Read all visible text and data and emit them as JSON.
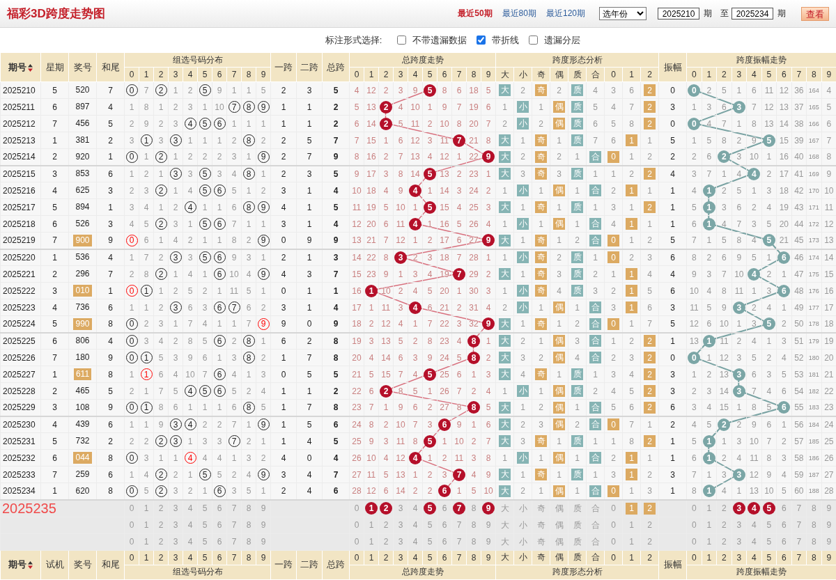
{
  "title": "福彩3D跨度走势图",
  "ranges": [
    {
      "label": "最近50期",
      "selected": true
    },
    {
      "label": "最近80期",
      "selected": false
    },
    {
      "label": "最近120期",
      "selected": false
    }
  ],
  "year_select": "选年份",
  "from": {
    "value": "2025210",
    "unit": "期"
  },
  "to_label": "至",
  "to": {
    "value": "2025234",
    "unit": "期"
  },
  "view_button": "查看",
  "options_label": "标注形式选择:",
  "options": [
    {
      "label": "不带遗漏数据",
      "checked": false
    },
    {
      "label": "带折线",
      "checked": true
    },
    {
      "label": "遗漏分层",
      "checked": false
    }
  ],
  "header": {
    "period": "期号",
    "weekday": "星期",
    "number": "奖号",
    "tail": "和尾",
    "dist_title": "组选号码分布",
    "dist_cols": [
      "0",
      "1",
      "2",
      "3",
      "4",
      "5",
      "6",
      "7",
      "8",
      "9"
    ],
    "span1": "一跨",
    "span2": "二跨",
    "span_total": "总跨",
    "span_title": "总跨度走势",
    "span_cols": [
      "0",
      "1",
      "2",
      "3",
      "4",
      "5",
      "6",
      "7",
      "8",
      "9"
    ],
    "shape_title": "跨度形态分析",
    "shape_cols": [
      "大",
      "小",
      "奇",
      "偶",
      "质",
      "合",
      "0",
      "1",
      "2"
    ],
    "amp": "振幅",
    "amp_title": "跨度振幅走势",
    "amp_cols": [
      "0",
      "1",
      "2",
      "3",
      "4",
      "5",
      "6",
      "7",
      "8",
      "9"
    ]
  },
  "rows": [
    {
      "period": "2025210",
      "weekday": "5",
      "number": "520",
      "highlighted": false,
      "tail": "7",
      "dist": [
        {
          "value": "0",
          "kind": "ring"
        },
        "7",
        {
          "value": "2",
          "kind": "ring"
        },
        "1",
        "2",
        {
          "value": "5",
          "kind": "ring"
        },
        "9",
        "1",
        "1",
        "5"
      ],
      "span1": "2",
      "span2": "3",
      "span": "5",
      "span_trend": [
        "4",
        "12",
        "2",
        "3",
        "9",
        {
          "value": "5",
          "kind": "ball"
        },
        "8",
        "6",
        "18",
        "5"
      ],
      "shape": [
        {
          "value": "大",
          "kind": "teal"
        },
        "2",
        {
          "value": "奇",
          "kind": "gold"
        },
        "2",
        {
          "value": "质",
          "kind": "teal"
        },
        "4",
        "3",
        "6",
        {
          "value": "2",
          "kind": "gold"
        }
      ],
      "amp": "0",
      "amp_trend": [
        {
          "value": "0",
          "kind": "ball"
        },
        "2",
        "5",
        "1",
        "6",
        "11",
        "12",
        "36",
        "164",
        "4"
      ]
    },
    {
      "period": "2025211",
      "weekday": "6",
      "number": "897",
      "highlighted": false,
      "tail": "4",
      "dist": [
        "1",
        "8",
        "1",
        "2",
        "3",
        "1",
        "10",
        {
          "value": "7",
          "kind": "ring"
        },
        {
          "value": "8",
          "kind": "ring"
        },
        {
          "value": "9",
          "kind": "ring"
        }
      ],
      "span1": "1",
      "span2": "1",
      "span": "2",
      "span_trend": [
        "5",
        "13",
        {
          "value": "2",
          "kind": "ball"
        },
        "4",
        "10",
        "1",
        "9",
        "7",
        "19",
        "6"
      ],
      "shape": [
        "1",
        {
          "value": "小",
          "kind": "teal"
        },
        "1",
        {
          "value": "偶",
          "kind": "gold"
        },
        {
          "value": "质",
          "kind": "teal"
        },
        "5",
        "4",
        "7",
        {
          "value": "2",
          "kind": "gold"
        }
      ],
      "amp": "3",
      "amp_trend": [
        "1",
        "3",
        "6",
        {
          "value": "3",
          "kind": "ball"
        },
        "7",
        "12",
        "13",
        "37",
        "165",
        "5"
      ]
    },
    {
      "period": "2025212",
      "weekday": "7",
      "number": "456",
      "highlighted": false,
      "tail": "5",
      "dist": [
        "2",
        "9",
        "2",
        "3",
        {
          "value": "4",
          "kind": "ring"
        },
        {
          "value": "5",
          "kind": "ring"
        },
        {
          "value": "6",
          "kind": "ring"
        },
        "1",
        "1",
        "1"
      ],
      "span1": "1",
      "span2": "1",
      "span": "2",
      "span_trend": [
        "6",
        "14",
        {
          "value": "2",
          "kind": "ball"
        },
        "5",
        "11",
        "2",
        "10",
        "8",
        "20",
        "7"
      ],
      "shape": [
        "2",
        {
          "value": "小",
          "kind": "teal"
        },
        "2",
        {
          "value": "偶",
          "kind": "gold"
        },
        {
          "value": "质",
          "kind": "teal"
        },
        "6",
        "5",
        "8",
        {
          "value": "2",
          "kind": "gold"
        }
      ],
      "amp": "0",
      "amp_trend": [
        {
          "value": "0",
          "kind": "ball"
        },
        "4",
        "7",
        "1",
        "8",
        "13",
        "14",
        "38",
        "166",
        "6"
      ]
    },
    {
      "period": "2025213",
      "weekday": "1",
      "number": "381",
      "highlighted": false,
      "tail": "2",
      "dist": [
        "3",
        {
          "value": "1",
          "kind": "ring"
        },
        "3",
        {
          "value": "3",
          "kind": "ring"
        },
        "1",
        "1",
        "1",
        "2",
        {
          "value": "8",
          "kind": "ring"
        },
        "2"
      ],
      "span1": "2",
      "span2": "5",
      "span": "7",
      "span_trend": [
        "7",
        "15",
        "1",
        "6",
        "12",
        "3",
        "11",
        {
          "value": "7",
          "kind": "ball"
        },
        "21",
        "8"
      ],
      "shape": [
        {
          "value": "大",
          "kind": "teal"
        },
        "1",
        {
          "value": "奇",
          "kind": "gold"
        },
        "1",
        {
          "value": "质",
          "kind": "teal"
        },
        "7",
        "6",
        {
          "value": "1",
          "kind": "gold"
        },
        "1"
      ],
      "amp": "5",
      "amp_trend": [
        "1",
        "5",
        "8",
        "2",
        "9",
        {
          "value": "5",
          "kind": "ball"
        },
        "15",
        "39",
        "167",
        "7"
      ]
    },
    {
      "period": "2025214",
      "weekday": "2",
      "number": "920",
      "highlighted": false,
      "tail": "1",
      "dist": [
        {
          "value": "0",
          "kind": "ring"
        },
        "1",
        {
          "value": "2",
          "kind": "ring"
        },
        "1",
        "2",
        "2",
        "2",
        "3",
        "1",
        {
          "value": "9",
          "kind": "ring"
        }
      ],
      "span1": "2",
      "span2": "7",
      "span": "9",
      "span_trend": [
        "8",
        "16",
        "2",
        "7",
        "13",
        "4",
        "12",
        "1",
        "22",
        {
          "value": "9",
          "kind": "ball"
        }
      ],
      "shape": [
        {
          "value": "大",
          "kind": "teal"
        },
        "2",
        {
          "value": "奇",
          "kind": "gold"
        },
        "2",
        "1",
        {
          "value": "合",
          "kind": "teal"
        },
        {
          "value": "0",
          "kind": "gold"
        },
        "1",
        "2"
      ],
      "amp": "2",
      "amp_trend": [
        "2",
        "6",
        {
          "value": "2",
          "kind": "ball"
        },
        "3",
        "10",
        "1",
        "16",
        "40",
        "168",
        "8"
      ]
    },
    {
      "period": "2025215",
      "weekday": "3",
      "number": "853",
      "highlighted": false,
      "tail": "6",
      "dist": [
        "1",
        "2",
        "1",
        {
          "value": "3",
          "kind": "ring"
        },
        "3",
        {
          "value": "5",
          "kind": "ring"
        },
        "3",
        "4",
        {
          "value": "8",
          "kind": "ring"
        },
        "1"
      ],
      "span1": "2",
      "span2": "3",
      "span": "5",
      "span_trend": [
        "9",
        "17",
        "3",
        "8",
        "14",
        {
          "value": "5",
          "kind": "ball"
        },
        "13",
        "2",
        "23",
        "1"
      ],
      "shape": [
        {
          "value": "大",
          "kind": "teal"
        },
        "3",
        {
          "value": "奇",
          "kind": "gold"
        },
        "3",
        {
          "value": "质",
          "kind": "teal"
        },
        "1",
        "1",
        "2",
        {
          "value": "2",
          "kind": "gold"
        }
      ],
      "amp": "4",
      "amp_trend": [
        "3",
        "7",
        "1",
        "4",
        {
          "value": "4",
          "kind": "ball"
        },
        "2",
        "17",
        "41",
        "169",
        "9"
      ]
    },
    {
      "period": "2025216",
      "weekday": "4",
      "number": "625",
      "highlighted": false,
      "tail": "3",
      "dist": [
        "2",
        "3",
        {
          "value": "2",
          "kind": "ring"
        },
        "1",
        "4",
        {
          "value": "5",
          "kind": "ring"
        },
        {
          "value": "6",
          "kind": "ring"
        },
        "5",
        "1",
        "2"
      ],
      "span1": "3",
      "span2": "1",
      "span": "4",
      "span_trend": [
        "10",
        "18",
        "4",
        "9",
        {
          "value": "4",
          "kind": "ball"
        },
        "1",
        "14",
        "3",
        "24",
        "2"
      ],
      "shape": [
        "1",
        {
          "value": "小",
          "kind": "teal"
        },
        "1",
        {
          "value": "偶",
          "kind": "gold"
        },
        "1",
        {
          "value": "合",
          "kind": "teal"
        },
        "2",
        {
          "value": "1",
          "kind": "gold"
        },
        "1"
      ],
      "amp": "1",
      "amp_trend": [
        "4",
        {
          "value": "1",
          "kind": "ball"
        },
        "2",
        "5",
        "1",
        "3",
        "18",
        "42",
        "170",
        "10"
      ]
    },
    {
      "period": "2025217",
      "weekday": "5",
      "number": "894",
      "highlighted": false,
      "tail": "1",
      "dist": [
        "3",
        "4",
        "1",
        "2",
        {
          "value": "4",
          "kind": "ring"
        },
        "1",
        "1",
        "6",
        {
          "value": "8",
          "kind": "ring"
        },
        {
          "value": "9",
          "kind": "ring"
        }
      ],
      "span1": "4",
      "span2": "1",
      "span": "5",
      "span_trend": [
        "11",
        "19",
        "5",
        "10",
        "1",
        {
          "value": "5",
          "kind": "ball"
        },
        "15",
        "4",
        "25",
        "3"
      ],
      "shape": [
        {
          "value": "大",
          "kind": "teal"
        },
        "1",
        {
          "value": "奇",
          "kind": "gold"
        },
        "1",
        {
          "value": "质",
          "kind": "teal"
        },
        "1",
        "3",
        "1",
        {
          "value": "2",
          "kind": "gold"
        }
      ],
      "amp": "1",
      "amp_trend": [
        "5",
        {
          "value": "1",
          "kind": "ball"
        },
        "3",
        "6",
        "2",
        "4",
        "19",
        "43",
        "171",
        "11"
      ]
    },
    {
      "period": "2025218",
      "weekday": "6",
      "number": "526",
      "highlighted": false,
      "tail": "3",
      "dist": [
        "4",
        "5",
        {
          "value": "2",
          "kind": "ring"
        },
        "3",
        "1",
        {
          "value": "5",
          "kind": "ring"
        },
        {
          "value": "6",
          "kind": "ring"
        },
        "7",
        "1",
        "1"
      ],
      "span1": "3",
      "span2": "1",
      "span": "4",
      "span_trend": [
        "12",
        "20",
        "6",
        "11",
        {
          "value": "4",
          "kind": "ball"
        },
        "1",
        "16",
        "5",
        "26",
        "4"
      ],
      "shape": [
        "1",
        {
          "value": "小",
          "kind": "teal"
        },
        "1",
        {
          "value": "偶",
          "kind": "gold"
        },
        "1",
        {
          "value": "合",
          "kind": "teal"
        },
        "4",
        {
          "value": "1",
          "kind": "gold"
        },
        "1"
      ],
      "amp": "1",
      "amp_trend": [
        "6",
        {
          "value": "1",
          "kind": "ball"
        },
        "4",
        "7",
        "3",
        "5",
        "20",
        "44",
        "172",
        "12"
      ]
    },
    {
      "period": "2025219",
      "weekday": "7",
      "number": "900",
      "highlighted": true,
      "tail": "9",
      "dist": [
        {
          "value": "0",
          "kind": "redring"
        },
        "6",
        "1",
        "4",
        "2",
        "1",
        "1",
        "8",
        "2",
        {
          "value": "9",
          "kind": "ring"
        }
      ],
      "span1": "0",
      "span2": "9",
      "span": "9",
      "span_trend": [
        "13",
        "21",
        "7",
        "12",
        "1",
        "2",
        "17",
        "6",
        "27",
        {
          "value": "9",
          "kind": "ball"
        }
      ],
      "shape": [
        {
          "value": "大",
          "kind": "teal"
        },
        "1",
        {
          "value": "奇",
          "kind": "gold"
        },
        "1",
        "2",
        {
          "value": "合",
          "kind": "teal"
        },
        {
          "value": "0",
          "kind": "gold"
        },
        "1",
        "2"
      ],
      "amp": "5",
      "amp_trend": [
        "7",
        "1",
        "5",
        "8",
        "4",
        {
          "value": "5",
          "kind": "ball"
        },
        "21",
        "45",
        "173",
        "13"
      ]
    },
    {
      "period": "2025220",
      "weekday": "1",
      "number": "536",
      "highlighted": false,
      "tail": "4",
      "dist": [
        "1",
        "7",
        "2",
        {
          "value": "3",
          "kind": "ring"
        },
        "3",
        {
          "value": "5",
          "kind": "ring"
        },
        {
          "value": "6",
          "kind": "ring"
        },
        "9",
        "3",
        "1"
      ],
      "span1": "2",
      "span2": "1",
      "span": "3",
      "span_trend": [
        "14",
        "22",
        "8",
        {
          "value": "3",
          "kind": "ball"
        },
        "2",
        "3",
        "18",
        "7",
        "28",
        "1"
      ],
      "shape": [
        "1",
        {
          "value": "小",
          "kind": "teal"
        },
        {
          "value": "奇",
          "kind": "gold"
        },
        "2",
        {
          "value": "质",
          "kind": "teal"
        },
        "1",
        {
          "value": "0",
          "kind": "gold"
        },
        "2",
        "3"
      ],
      "amp": "6",
      "amp_trend": [
        "8",
        "2",
        "6",
        "9",
        "5",
        "1",
        {
          "value": "6",
          "kind": "ball"
        },
        "46",
        "174",
        "14"
      ]
    },
    {
      "period": "2025221",
      "weekday": "2",
      "number": "296",
      "highlighted": false,
      "tail": "7",
      "dist": [
        "2",
        "8",
        {
          "value": "2",
          "kind": "ring"
        },
        "1",
        "4",
        "1",
        {
          "value": "6",
          "kind": "ring"
        },
        "10",
        "4",
        {
          "value": "9",
          "kind": "ring"
        }
      ],
      "span1": "4",
      "span2": "3",
      "span": "7",
      "span_trend": [
        "15",
        "23",
        "9",
        "1",
        "3",
        "4",
        "19",
        {
          "value": "7",
          "kind": "ball"
        },
        "29",
        "2"
      ],
      "shape": [
        {
          "value": "大",
          "kind": "teal"
        },
        "1",
        {
          "value": "奇",
          "kind": "gold"
        },
        "3",
        {
          "value": "质",
          "kind": "teal"
        },
        "2",
        "1",
        {
          "value": "1",
          "kind": "gold"
        },
        "4"
      ],
      "amp": "4",
      "amp_trend": [
        "9",
        "3",
        "7",
        "10",
        {
          "value": "4",
          "kind": "ball"
        },
        "2",
        "1",
        "47",
        "175",
        "15"
      ]
    },
    {
      "period": "2025222",
      "weekday": "3",
      "number": "010",
      "highlighted": true,
      "tail": "1",
      "dist": [
        {
          "value": "0",
          "kind": "redring"
        },
        {
          "value": "1",
          "kind": "ring"
        },
        "1",
        "2",
        "5",
        "2",
        "1",
        "11",
        "5",
        "1"
      ],
      "span1": "0",
      "span2": "1",
      "span": "1",
      "span_trend": [
        "16",
        {
          "value": "1",
          "kind": "ball"
        },
        "10",
        "2",
        "4",
        "5",
        "20",
        "1",
        "30",
        "3"
      ],
      "shape": [
        "1",
        {
          "value": "小",
          "kind": "teal"
        },
        {
          "value": "奇",
          "kind": "gold"
        },
        "4",
        {
          "value": "质",
          "kind": "teal"
        },
        "3",
        "2",
        {
          "value": "1",
          "kind": "gold"
        },
        "5"
      ],
      "amp": "6",
      "amp_trend": [
        "10",
        "4",
        "8",
        "11",
        "1",
        "3",
        {
          "value": "6",
          "kind": "ball"
        },
        "48",
        "176",
        "16"
      ]
    },
    {
      "period": "2025223",
      "weekday": "4",
      "number": "736",
      "highlighted": false,
      "tail": "6",
      "dist": [
        "1",
        "1",
        "2",
        {
          "value": "3",
          "kind": "ring"
        },
        "6",
        "3",
        {
          "value": "6",
          "kind": "ring"
        },
        {
          "value": "7",
          "kind": "ring"
        },
        "6",
        "2"
      ],
      "span1": "3",
      "span2": "1",
      "span": "4",
      "span_trend": [
        "17",
        "1",
        "11",
        "3",
        {
          "value": "4",
          "kind": "ball"
        },
        "6",
        "21",
        "2",
        "31",
        "4"
      ],
      "shape": [
        "2",
        {
          "value": "小",
          "kind": "teal"
        },
        "1",
        {
          "value": "偶",
          "kind": "gold"
        },
        "1",
        {
          "value": "合",
          "kind": "teal"
        },
        "3",
        {
          "value": "1",
          "kind": "gold"
        },
        "6"
      ],
      "amp": "3",
      "amp_trend": [
        "11",
        "5",
        "9",
        {
          "value": "3",
          "kind": "ball"
        },
        "2",
        "4",
        "1",
        "49",
        "177",
        "17"
      ]
    },
    {
      "period": "2025224",
      "weekday": "5",
      "number": "990",
      "highlighted": true,
      "tail": "8",
      "dist": [
        {
          "value": "0",
          "kind": "ring"
        },
        "2",
        "3",
        "1",
        "7",
        "4",
        "1",
        "1",
        "7",
        {
          "value": "9",
          "kind": "redring"
        }
      ],
      "span1": "9",
      "span2": "0",
      "span": "9",
      "span_trend": [
        "18",
        "2",
        "12",
        "4",
        "1",
        "7",
        "22",
        "3",
        "32",
        {
          "value": "9",
          "kind": "ball"
        }
      ],
      "shape": [
        {
          "value": "大",
          "kind": "teal"
        },
        "1",
        {
          "value": "奇",
          "kind": "gold"
        },
        "1",
        "2",
        {
          "value": "合",
          "kind": "teal"
        },
        {
          "value": "0",
          "kind": "gold"
        },
        "1",
        "7"
      ],
      "amp": "5",
      "amp_trend": [
        "12",
        "6",
        "10",
        "1",
        "3",
        {
          "value": "5",
          "kind": "ball"
        },
        "2",
        "50",
        "178",
        "18"
      ]
    },
    {
      "period": "2025225",
      "weekday": "6",
      "number": "806",
      "highlighted": false,
      "tail": "4",
      "dist": [
        {
          "value": "0",
          "kind": "ring"
        },
        "3",
        "4",
        "2",
        "8",
        "5",
        {
          "value": "6",
          "kind": "ring"
        },
        "2",
        {
          "value": "8",
          "kind": "ring"
        },
        "1"
      ],
      "span1": "6",
      "span2": "2",
      "span": "8",
      "span_trend": [
        "19",
        "3",
        "13",
        "5",
        "2",
        "8",
        "23",
        "4",
        {
          "value": "8",
          "kind": "ball"
        },
        "1"
      ],
      "shape": [
        {
          "value": "大",
          "kind": "teal"
        },
        "2",
        "1",
        {
          "value": "偶",
          "kind": "gold"
        },
        "3",
        {
          "value": "合",
          "kind": "teal"
        },
        "1",
        "2",
        {
          "value": "2",
          "kind": "gold"
        }
      ],
      "amp": "1",
      "amp_trend": [
        "13",
        {
          "value": "1",
          "kind": "ball"
        },
        "11",
        "2",
        "4",
        "1",
        "3",
        "51",
        "179",
        "19"
      ]
    },
    {
      "period": "2025226",
      "weekday": "7",
      "number": "180",
      "highlighted": false,
      "tail": "9",
      "dist": [
        {
          "value": "0",
          "kind": "ring"
        },
        {
          "value": "1",
          "kind": "ring"
        },
        "5",
        "3",
        "9",
        "6",
        "1",
        "3",
        {
          "value": "8",
          "kind": "ring"
        },
        "2"
      ],
      "span1": "1",
      "span2": "7",
      "span": "8",
      "span_trend": [
        "20",
        "4",
        "14",
        "6",
        "3",
        "9",
        "24",
        "5",
        {
          "value": "8",
          "kind": "ball"
        },
        "2"
      ],
      "shape": [
        {
          "value": "大",
          "kind": "teal"
        },
        "3",
        "2",
        {
          "value": "偶",
          "kind": "gold"
        },
        "4",
        {
          "value": "合",
          "kind": "teal"
        },
        "2",
        "3",
        {
          "value": "2",
          "kind": "gold"
        }
      ],
      "amp": "0",
      "amp_trend": [
        {
          "value": "0",
          "kind": "ball"
        },
        "1",
        "12",
        "3",
        "5",
        "2",
        "4",
        "52",
        "180",
        "20"
      ]
    },
    {
      "period": "2025227",
      "weekday": "1",
      "number": "611",
      "highlighted": true,
      "tail": "8",
      "dist": [
        "1",
        {
          "value": "1",
          "kind": "redring"
        },
        "6",
        "4",
        "10",
        "7",
        {
          "value": "6",
          "kind": "ring"
        },
        "4",
        "1",
        "3"
      ],
      "span1": "0",
      "span2": "5",
      "span": "5",
      "span_trend": [
        "21",
        "5",
        "15",
        "7",
        "4",
        {
          "value": "5",
          "kind": "ball"
        },
        "25",
        "6",
        "1",
        "3"
      ],
      "shape": [
        {
          "value": "大",
          "kind": "teal"
        },
        "4",
        {
          "value": "奇",
          "kind": "gold"
        },
        "1",
        {
          "value": "质",
          "kind": "teal"
        },
        "1",
        "3",
        "4",
        {
          "value": "2",
          "kind": "gold"
        }
      ],
      "amp": "3",
      "amp_trend": [
        "1",
        "2",
        "13",
        {
          "value": "3",
          "kind": "ball"
        },
        "6",
        "3",
        "5",
        "53",
        "181",
        "21"
      ]
    },
    {
      "period": "2025228",
      "weekday": "2",
      "number": "465",
      "highlighted": false,
      "tail": "5",
      "dist": [
        "2",
        "1",
        "7",
        "5",
        {
          "value": "4",
          "kind": "ring"
        },
        {
          "value": "5",
          "kind": "ring"
        },
        {
          "value": "6",
          "kind": "ring"
        },
        "5",
        "2",
        "4"
      ],
      "span1": "1",
      "span2": "1",
      "span": "2",
      "span_trend": [
        "22",
        "6",
        {
          "value": "2",
          "kind": "ball"
        },
        "8",
        "5",
        "1",
        "26",
        "7",
        "2",
        "4"
      ],
      "shape": [
        "1",
        {
          "value": "小",
          "kind": "teal"
        },
        "1",
        {
          "value": "偶",
          "kind": "gold"
        },
        {
          "value": "质",
          "kind": "teal"
        },
        "2",
        "4",
        "5",
        {
          "value": "2",
          "kind": "gold"
        }
      ],
      "amp": "3",
      "amp_trend": [
        "2",
        "3",
        "14",
        {
          "value": "3",
          "kind": "ball"
        },
        "7",
        "4",
        "6",
        "54",
        "182",
        "22"
      ]
    },
    {
      "period": "2025229",
      "weekday": "3",
      "number": "108",
      "highlighted": false,
      "tail": "9",
      "dist": [
        {
          "value": "0",
          "kind": "ring"
        },
        {
          "value": "1",
          "kind": "ring"
        },
        "8",
        "6",
        "1",
        "1",
        "1",
        "6",
        {
          "value": "8",
          "kind": "ring"
        },
        "5"
      ],
      "span1": "1",
      "span2": "7",
      "span": "8",
      "span_trend": [
        "23",
        "7",
        "1",
        "9",
        "6",
        "2",
        "27",
        "8",
        {
          "value": "8",
          "kind": "ball"
        },
        "5"
      ],
      "shape": [
        {
          "value": "大",
          "kind": "teal"
        },
        "1",
        "2",
        {
          "value": "偶",
          "kind": "gold"
        },
        "1",
        {
          "value": "合",
          "kind": "teal"
        },
        "5",
        "6",
        {
          "value": "2",
          "kind": "gold"
        }
      ],
      "amp": "6",
      "amp_trend": [
        "3",
        "4",
        "15",
        "1",
        "8",
        "5",
        {
          "value": "6",
          "kind": "ball"
        },
        "55",
        "183",
        "23"
      ]
    },
    {
      "period": "2025230",
      "weekday": "4",
      "number": "439",
      "highlighted": false,
      "tail": "6",
      "dist": [
        "1",
        "1",
        "9",
        {
          "value": "3",
          "kind": "ring"
        },
        {
          "value": "4",
          "kind": "ring"
        },
        "2",
        "2",
        "7",
        "1",
        {
          "value": "9",
          "kind": "ring"
        }
      ],
      "span1": "1",
      "span2": "5",
      "span": "6",
      "span_trend": [
        "24",
        "8",
        "2",
        "10",
        "7",
        "3",
        {
          "value": "6",
          "kind": "ball"
        },
        "9",
        "1",
        "6"
      ],
      "shape": [
        {
          "value": "大",
          "kind": "teal"
        },
        "2",
        "3",
        {
          "value": "偶",
          "kind": "gold"
        },
        "2",
        {
          "value": "合",
          "kind": "teal"
        },
        {
          "value": "0",
          "kind": "gold"
        },
        "7",
        "1"
      ],
      "amp": "2",
      "amp_trend": [
        "4",
        "5",
        {
          "value": "2",
          "kind": "ball"
        },
        "2",
        "9",
        "6",
        "1",
        "56",
        "184",
        "24"
      ]
    },
    {
      "period": "2025231",
      "weekday": "5",
      "number": "732",
      "highlighted": false,
      "tail": "2",
      "dist": [
        "2",
        "2",
        {
          "value": "2",
          "kind": "ring"
        },
        {
          "value": "3",
          "kind": "ring"
        },
        "1",
        "3",
        "3",
        {
          "value": "7",
          "kind": "ring"
        },
        "2",
        "1"
      ],
      "span1": "1",
      "span2": "4",
      "span": "5",
      "span_trend": [
        "25",
        "9",
        "3",
        "11",
        "8",
        {
          "value": "5",
          "kind": "ball"
        },
        "1",
        "10",
        "2",
        "7"
      ],
      "shape": [
        {
          "value": "大",
          "kind": "teal"
        },
        "3",
        {
          "value": "奇",
          "kind": "gold"
        },
        "1",
        {
          "value": "质",
          "kind": "teal"
        },
        "1",
        "1",
        "8",
        {
          "value": "2",
          "kind": "gold"
        }
      ],
      "amp": "1",
      "amp_trend": [
        "5",
        {
          "value": "1",
          "kind": "ball"
        },
        "1",
        "3",
        "10",
        "7",
        "2",
        "57",
        "185",
        "25"
      ]
    },
    {
      "period": "2025232",
      "weekday": "6",
      "number": "044",
      "highlighted": true,
      "tail": "8",
      "dist": [
        {
          "value": "0",
          "kind": "ring"
        },
        "3",
        "1",
        "1",
        {
          "value": "4",
          "kind": "redring"
        },
        "4",
        "4",
        "1",
        "3",
        "2"
      ],
      "span1": "4",
      "span2": "0",
      "span": "4",
      "span_trend": [
        "26",
        "10",
        "4",
        "12",
        {
          "value": "4",
          "kind": "ball"
        },
        "1",
        "2",
        "11",
        "3",
        "8"
      ],
      "shape": [
        "1",
        {
          "value": "小",
          "kind": "teal"
        },
        "1",
        {
          "value": "偶",
          "kind": "gold"
        },
        "1",
        {
          "value": "合",
          "kind": "teal"
        },
        "2",
        {
          "value": "1",
          "kind": "gold"
        },
        "1"
      ],
      "amp": "1",
      "amp_trend": [
        "6",
        {
          "value": "1",
          "kind": "ball"
        },
        "2",
        "4",
        "11",
        "8",
        "3",
        "58",
        "186",
        "26"
      ]
    },
    {
      "period": "2025233",
      "weekday": "7",
      "number": "259",
      "highlighted": false,
      "tail": "6",
      "dist": [
        "1",
        "4",
        {
          "value": "2",
          "kind": "ring"
        },
        "2",
        "1",
        {
          "value": "5",
          "kind": "ring"
        },
        "5",
        "2",
        "4",
        {
          "value": "9",
          "kind": "ring"
        }
      ],
      "span1": "3",
      "span2": "4",
      "span": "7",
      "span_trend": [
        "27",
        "11",
        "5",
        "13",
        "1",
        "2",
        "3",
        {
          "value": "7",
          "kind": "ball"
        },
        "4",
        "9"
      ],
      "shape": [
        {
          "value": "大",
          "kind": "teal"
        },
        "1",
        {
          "value": "奇",
          "kind": "gold"
        },
        "1",
        {
          "value": "质",
          "kind": "teal"
        },
        "1",
        "3",
        {
          "value": "1",
          "kind": "gold"
        },
        "2"
      ],
      "amp": "3",
      "amp_trend": [
        "7",
        "1",
        "3",
        {
          "value": "3",
          "kind": "ball"
        },
        "12",
        "9",
        "4",
        "59",
        "187",
        "27"
      ]
    },
    {
      "period": "2025234",
      "weekday": "1",
      "number": "620",
      "highlighted": false,
      "tail": "8",
      "dist": [
        {
          "value": "0",
          "kind": "ring"
        },
        "5",
        {
          "value": "2",
          "kind": "ring"
        },
        "3",
        "2",
        "1",
        {
          "value": "6",
          "kind": "ring"
        },
        "3",
        "5",
        "1"
      ],
      "span1": "2",
      "span2": "4",
      "span": "6",
      "span_trend": [
        "28",
        "12",
        "6",
        "14",
        "2",
        "2",
        {
          "value": "6",
          "kind": "ball"
        },
        "1",
        "5",
        "10"
      ],
      "shape": [
        {
          "value": "大",
          "kind": "teal"
        },
        "2",
        "1",
        {
          "value": "偶",
          "kind": "gold"
        },
        "1",
        {
          "value": "合",
          "kind": "teal"
        },
        {
          "value": "0",
          "kind": "gold"
        },
        "1",
        "3"
      ],
      "amp": "1",
      "amp_trend": [
        "8",
        {
          "value": "1",
          "kind": "ball"
        },
        "4",
        "1",
        "13",
        "10",
        "5",
        "60",
        "188",
        "28"
      ]
    }
  ],
  "forecast_rows": [
    {
      "period": "2025235",
      "dist": [
        "0",
        "1",
        "2",
        "3",
        "4",
        "5",
        "6",
        "7",
        "8",
        "9"
      ],
      "span_trend": [
        "0",
        {
          "value": "1",
          "kind": "ball"
        },
        {
          "value": "2",
          "kind": "ball"
        },
        "3",
        "4",
        {
          "value": "5",
          "kind": "ball"
        },
        "6",
        {
          "value": "7",
          "kind": "ball"
        },
        "8",
        {
          "value": "9",
          "kind": "ball"
        }
      ],
      "shape": [
        "大",
        "小",
        "奇",
        "偶",
        "质",
        "合",
        "0",
        {
          "value": "1",
          "kind": "gold"
        },
        {
          "value": "2",
          "kind": "gold"
        }
      ],
      "amp_trend": [
        "0",
        "1",
        "2",
        {
          "value": "3",
          "kind": "ball"
        },
        {
          "value": "4",
          "kind": "ball"
        },
        {
          "value": "5",
          "kind": "ball"
        },
        "6",
        "7",
        "8",
        "9"
      ]
    },
    {
      "dist": [
        "0",
        "1",
        "2",
        "3",
        "4",
        "5",
        "6",
        "7",
        "8",
        "9"
      ],
      "span_trend": [
        "0",
        "1",
        "2",
        "3",
        "4",
        "5",
        "6",
        "7",
        "8",
        "9"
      ],
      "shape": [
        "大",
        "小",
        "奇",
        "偶",
        "质",
        "合",
        "0",
        "1",
        "2"
      ],
      "amp_trend": [
        "0",
        "1",
        "2",
        "3",
        "4",
        "5",
        "6",
        "7",
        "8",
        "9"
      ]
    },
    {
      "dist": [
        "0",
        "1",
        "2",
        "3",
        "4",
        "5",
        "6",
        "7",
        "8",
        "9"
      ],
      "span_trend": [
        "0",
        "1",
        "2",
        "3",
        "4",
        "5",
        "6",
        "7",
        "8",
        "9"
      ],
      "shape": [
        "大",
        "小",
        "奇",
        "偶",
        "质",
        "合",
        "0",
        "1",
        "2"
      ],
      "amp_trend": [
        "0",
        "1",
        "2",
        "3",
        "4",
        "5",
        "6",
        "7",
        "8",
        "9"
      ]
    }
  ],
  "footer": {
    "period": "期号",
    "weekday": "试机",
    "number": "奖号",
    "tail": "和尾",
    "dist_title": "组选号码分布",
    "dist_cols": [
      "0",
      "1",
      "2",
      "3",
      "4",
      "5",
      "6",
      "7",
      "8",
      "9"
    ],
    "span1": "一跨",
    "span2": "二跨",
    "span_total": "总跨",
    "span_title": "总跨度走势",
    "span_cols": [
      "0",
      "1",
      "2",
      "3",
      "4",
      "5",
      "6",
      "7",
      "8",
      "9"
    ],
    "shape_title": "跨度形态分析",
    "shape_cols": [
      "大",
      "小",
      "奇",
      "偶",
      "质",
      "合",
      "0",
      "1",
      "2"
    ],
    "amp": "振幅",
    "amp_title": "跨度振幅走势",
    "amp_cols": [
      "0",
      "1",
      "2",
      "3",
      "4",
      "5",
      "6",
      "7",
      "8",
      "9"
    ]
  }
}
